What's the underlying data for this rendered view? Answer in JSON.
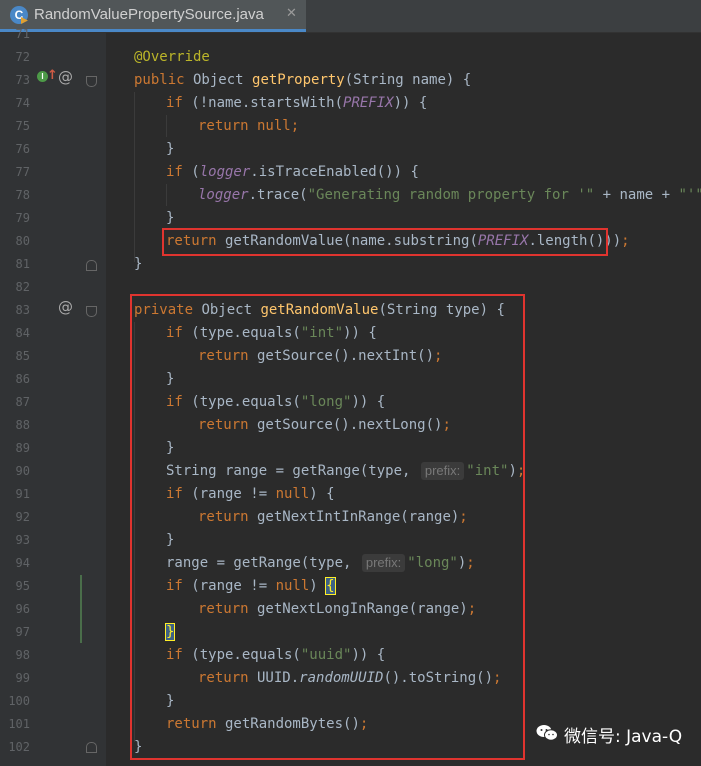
{
  "tab": {
    "title": "RandomValuePropertySource.java",
    "close": "✕"
  },
  "line_numbers": [
    "71",
    "72",
    "73",
    "74",
    "75",
    "76",
    "77",
    "78",
    "79",
    "80",
    "81",
    "82",
    "83",
    "84",
    "85",
    "86",
    "87",
    "88",
    "89",
    "90",
    "91",
    "92",
    "93",
    "94",
    "95",
    "96",
    "97",
    "98",
    "99",
    "100",
    "101",
    "102"
  ],
  "code": {
    "l72": "@Override",
    "l73_public": "public",
    "l73_type": " Object ",
    "l73_fn": "getProperty",
    "l73_rest": "(String name) {",
    "l74_if": "if",
    "l74_a": " (!name.startsWith(",
    "l74_const": "PREFIX",
    "l74_b": ")) {",
    "l75_ret": "return",
    "l75_null": " null",
    "l75_semi": ";",
    "l76": "}",
    "l77_if": "if",
    "l77_a": " (",
    "l77_logger": "logger",
    "l77_b": ".isTraceEnabled()) {",
    "l78_logger": "logger",
    "l78_a": ".trace(",
    "l78_s1": "\"Generating random property for '\"",
    "l78_b": " + name + ",
    "l78_s2": "\"'\"",
    "l78_c": ");",
    "l79": "}",
    "l80_ret": "return",
    "l80_a": " getRandomValue(name.substring(",
    "l80_const": "PREFIX",
    "l80_b": ".length()))",
    "l80_semi": ";",
    "l81": "}",
    "l83_private": "private",
    "l83_type": " Object ",
    "l83_fn": "getRandomValue",
    "l83_rest": "(String type) {",
    "l84_if": "if",
    "l84_a": " (type.equals(",
    "l84_s": "\"int\"",
    "l84_b": ")) {",
    "l85_ret": "return",
    "l85_a": " getSource().nextInt()",
    "l85_semi": ";",
    "l86": "}",
    "l87_if": "if",
    "l87_a": " (type.equals(",
    "l87_s": "\"long\"",
    "l87_b": ")) {",
    "l88_ret": "return",
    "l88_a": " getSource().nextLong()",
    "l88_semi": ";",
    "l89": "}",
    "l90_a": "String range = getRange(type, ",
    "l90_hint": "prefix:",
    "l90_s": "\"int\"",
    "l90_b": ")",
    "l90_semi": ";",
    "l91_if": "if",
    "l91_a": " (range != ",
    "l91_null": "null",
    "l91_b": ") {",
    "l92_ret": "return",
    "l92_a": " getNextIntInRange(range)",
    "l92_semi": ";",
    "l93": "}",
    "l94_a": "range = getRange(type, ",
    "l94_hint": "prefix:",
    "l94_s": "\"long\"",
    "l94_b": ")",
    "l94_semi": ";",
    "l95_if": "if",
    "l95_a": " (range != ",
    "l95_null": "null",
    "l95_b": ") ",
    "l95_brace": "{",
    "l96_ret": "return",
    "l96_a": " getNextLongInRange(range)",
    "l96_semi": ";",
    "l97_brace": "}",
    "l98_if": "if",
    "l98_a": " (type.equals(",
    "l98_s": "\"uuid\"",
    "l98_b": ")) {",
    "l99_ret": "return",
    "l99_a": " UUID.",
    "l99_m": "randomUUID",
    "l99_b": "().toString()",
    "l99_semi": ";",
    "l100": "}",
    "l101_ret": "return",
    "l101_a": " getRandomBytes()",
    "l101_semi": ";",
    "l102": "}"
  },
  "watermark": {
    "text": "微信号: Java-Q"
  },
  "colors": {
    "keyword": "#cc7832",
    "function": "#ffc66d",
    "string": "#6a8759",
    "constant": "#9876aa",
    "highlight_box": "#e0342f"
  }
}
